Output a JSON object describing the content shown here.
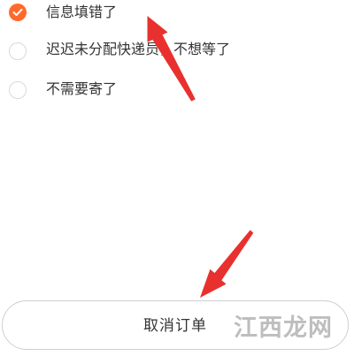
{
  "reasons": [
    {
      "label": "信息填错了",
      "selected": true
    },
    {
      "label": "迟迟未分配快递员，不想等了",
      "selected": false
    },
    {
      "label": "不需要寄了",
      "selected": false
    }
  ],
  "cancel_button": {
    "label": "取消订单"
  },
  "watermark": {
    "text": "江西龙网"
  },
  "colors": {
    "accent": "#ff6a2b",
    "annotation_arrow": "#e8312f",
    "text": "#333333",
    "border": "#cfcfcf"
  },
  "icons": {
    "selected": "check-circle-icon",
    "unselected": "empty-circle-icon",
    "annotation": "red-arrow-icon"
  }
}
